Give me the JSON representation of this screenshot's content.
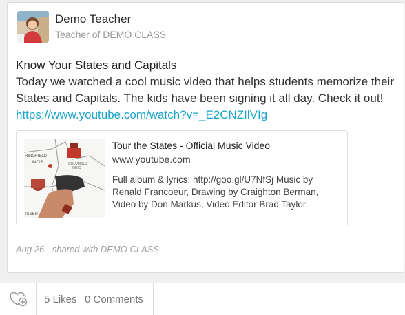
{
  "post": {
    "author_name": "Demo Teacher",
    "author_role": "Teacher of DEMO CLASS",
    "title": "Know Your States and Capitals",
    "text": "Today we watched a cool music video that helps students memorize their States and Capitals. The kids have been signing it all day. Check it out!",
    "link": "https://www.youtube.com/watch?v=_E2CNZIlVIg",
    "meta": "Aug 26 - shared with DEMO CLASS"
  },
  "preview": {
    "title": "Tour the States - Official Music Video",
    "domain": "www.youtube.com",
    "description": "Full album & lyrics: http://goo.gl/U7NfSj Music by Renald Francoeur, Drawing by Craighton Berman, Video by Don Markus, Video Editor Brad Taylor.",
    "thumbnail_labels": [
      "RINGFIELD",
      "LINOIS",
      "COLUMBUS",
      "OHIO",
      "ISSER"
    ]
  },
  "footer": {
    "likes": "5 Likes",
    "comments": "0 Comments",
    "like_icon": "heart-plus-icon"
  },
  "colors": {
    "link": "#1ba5c8",
    "meta": "#a0a0a0",
    "background": "#f0f0f0"
  }
}
